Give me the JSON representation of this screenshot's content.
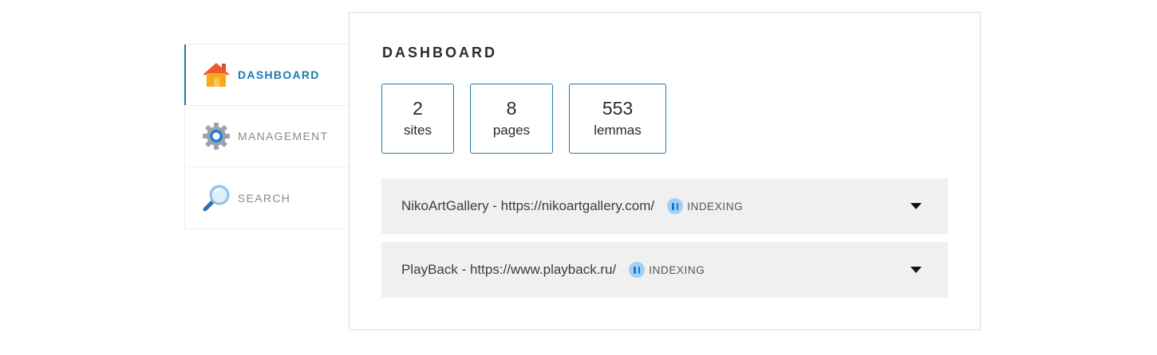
{
  "sidebar": {
    "items": [
      {
        "label": "DASHBOARD",
        "icon": "house-icon",
        "active": true
      },
      {
        "label": "MANAGEMENT",
        "icon": "gear-icon",
        "active": false
      },
      {
        "label": "SEARCH",
        "icon": "magnifier-icon",
        "active": false
      }
    ]
  },
  "main": {
    "title": "DASHBOARD",
    "stats": [
      {
        "value": "2",
        "label": "sites"
      },
      {
        "value": "8",
        "label": "pages"
      },
      {
        "value": "553",
        "label": "lemmas"
      }
    ],
    "sites": [
      {
        "name": "NikoArtGallery - https://nikoartgallery.com/",
        "status": "INDEXING",
        "status_icon": "pause-icon",
        "toggle_icon": "caret-down-icon"
      },
      {
        "name": "PlayBack - https://www.playback.ru/",
        "status": "INDEXING",
        "status_icon": "pause-icon",
        "toggle_icon": "caret-down-icon"
      }
    ]
  },
  "colors": {
    "accent": "#1a7ab5",
    "row_bg": "#f0f0f0",
    "status_bg": "#9fd0f5",
    "status_fg": "#1976d2"
  }
}
